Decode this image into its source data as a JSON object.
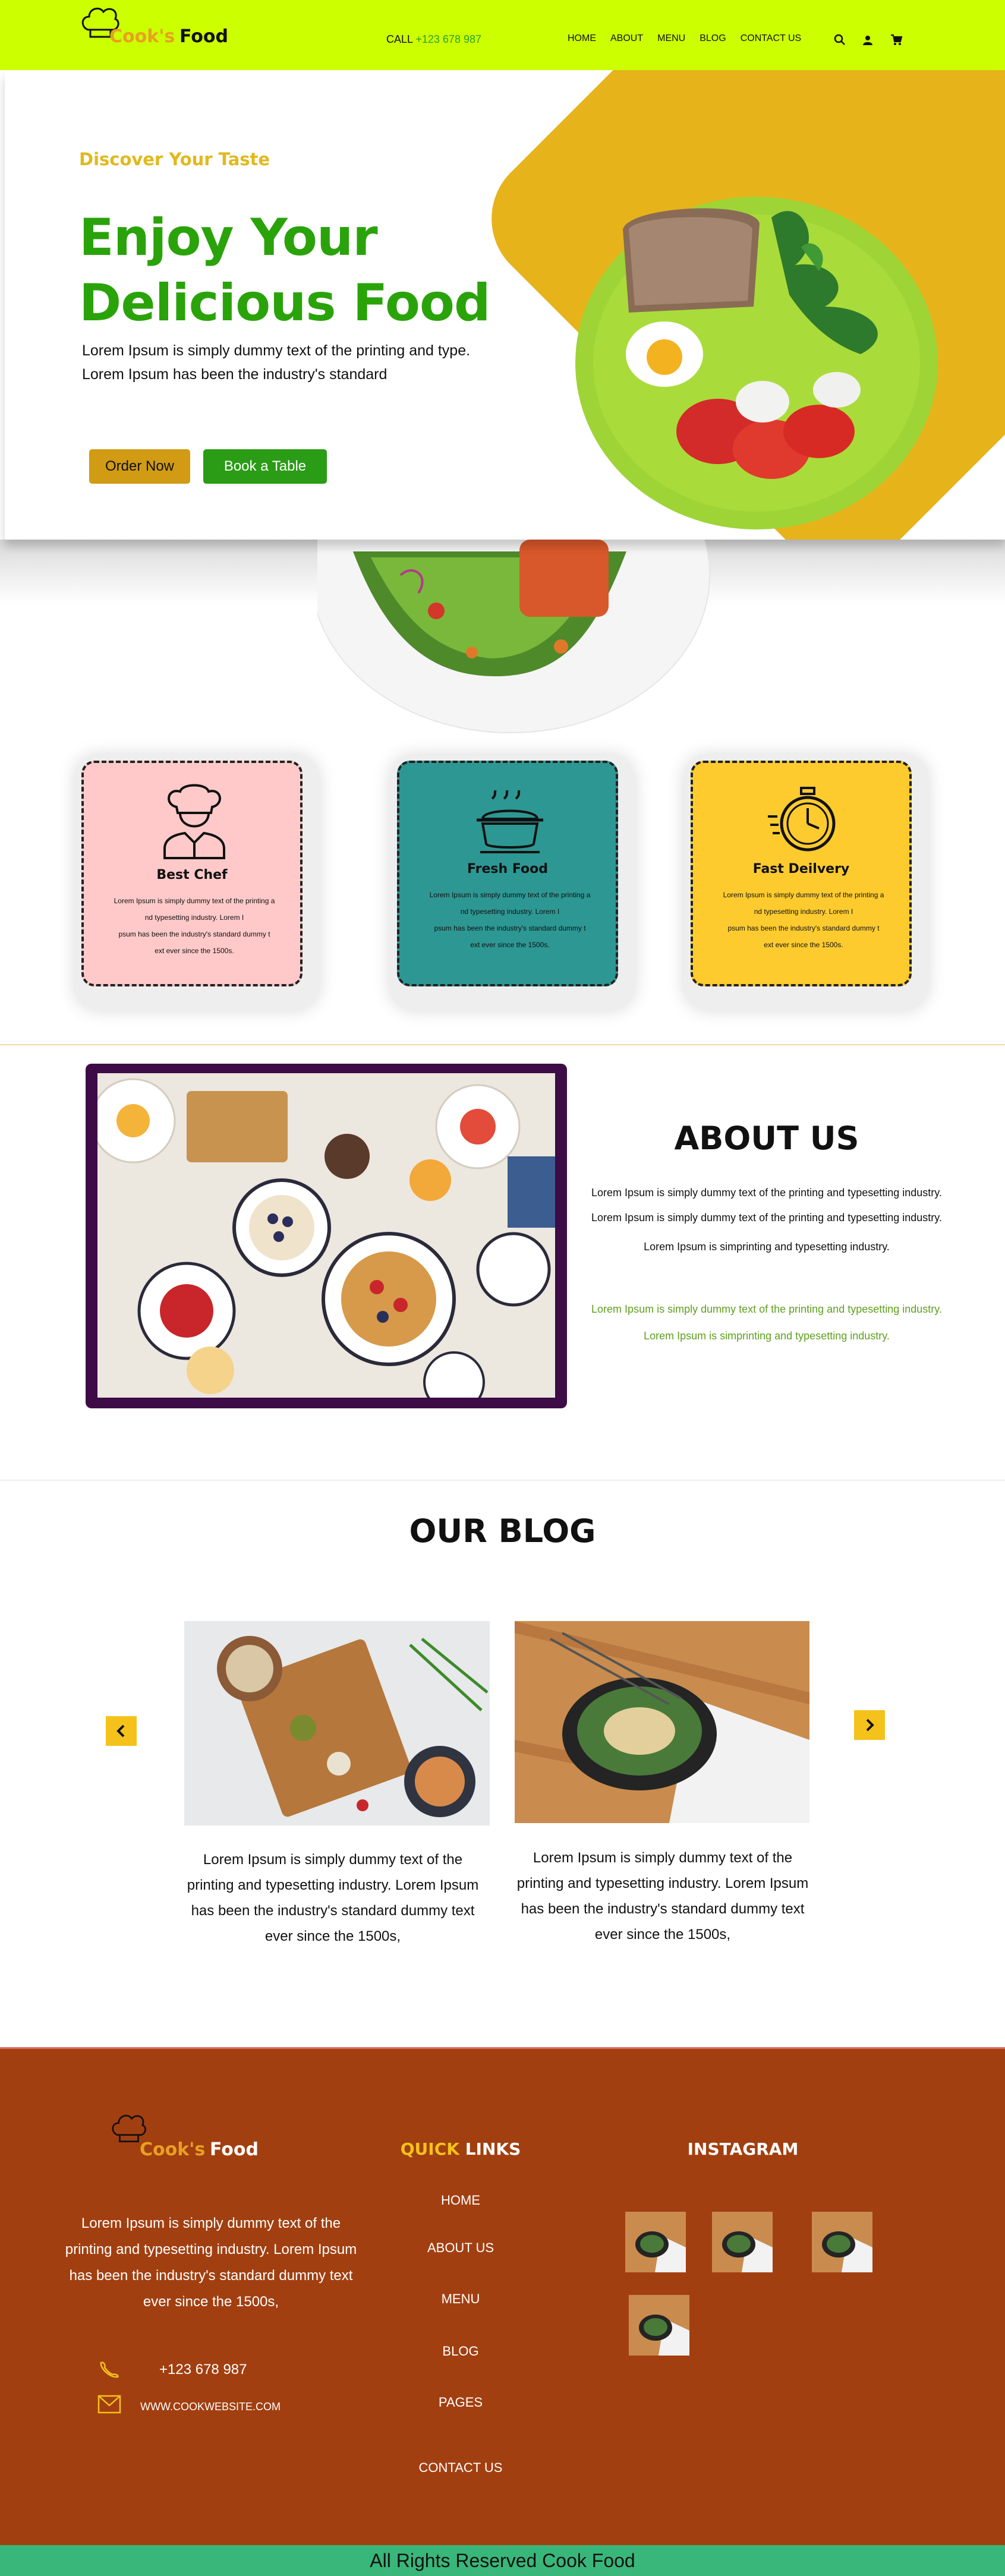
{
  "brand": {
    "name_part1": "Cook's",
    "name_part2": "Food"
  },
  "header": {
    "call_label": "CALL",
    "call_number": "+123 678 987",
    "nav": [
      "HOME",
      "ABOUT",
      "MENU",
      "BLOG",
      "CONTACT US"
    ],
    "icons": [
      "search-icon",
      "user-icon",
      "cart-icon"
    ]
  },
  "hero": {
    "tagline": "Discover Your Taste",
    "title_line1": "Enjoy Your",
    "title_line2": "Delicious Food",
    "text_line1": "Lorem Ipsum is simply dummy text of the printing and type.",
    "text_line2": "Lorem Ipsum has been the industry's standard",
    "order_button": "Order Now",
    "book_button": "Book a Table"
  },
  "features": [
    {
      "title": "Best Chef",
      "icon": "chef-icon",
      "color": "#ffc9c9",
      "lines": [
        "Lorem Ipsum is simply dummy text of the printing a",
        "nd typesetting industry. Lorem I",
        "psum has been the industry's standard dummy t",
        "ext ever since the 1500s."
      ]
    },
    {
      "title": "Fresh Food",
      "icon": "food-pot-icon",
      "color": "#2d9793",
      "lines": [
        "Lorem Ipsum is simply dummy text of the printing a",
        "nd typesetting industry. Lorem I",
        "psum has been the industry's standard dummy t",
        "ext ever since the 1500s."
      ]
    },
    {
      "title": "Fast Deilvery",
      "icon": "stopwatch-icon",
      "color": "#fecb2f",
      "lines": [
        "Lorem Ipsum is simply dummy text of the printing a",
        "nd typesetting industry. Lorem I",
        "psum has been the industry's standard dummy t",
        "ext ever since the 1500s."
      ]
    }
  ],
  "about": {
    "title": "ABOUT US",
    "line1": "Lorem Ipsum is simply dummy text of the printing and typesetting industry.",
    "line2": "Lorem Ipsum is simply dummy text of the printing and typesetting industry.",
    "line3": "Lorem Ipsum is simprinting and typesetting industry.",
    "line4": "Lorem Ipsum is simply dummy text of the printing and typesetting industry.",
    "line5": "Lorem Ipsum is simprinting and typesetting industry."
  },
  "blog": {
    "title": "OUR BLOG",
    "posts": [
      {
        "lines": [
          "Lorem Ipsum is simply dummy text of the",
          "printing and typesetting industry. Lorem Ipsum",
          "has been the industry's standard dummy text",
          "ever since the 1500s,"
        ]
      },
      {
        "lines": [
          "Lorem Ipsum is simply dummy text of the",
          "printing and typesetting industry. Lorem Ipsum",
          "has been the industry's standard dummy text",
          "ever since the 1500s,"
        ]
      }
    ],
    "prev_icon": "chevron-left-icon",
    "next_icon": "chevron-right-icon"
  },
  "footer": {
    "desc_lines": [
      "Lorem Ipsum is simply dummy text of the",
      "printing and typesetting industry. Lorem Ipsum",
      "has been the industry's standard dummy text",
      "ever since the 1500s,"
    ],
    "phone": "+123 678 987",
    "website": "WWW.COOKWEBSITE.COM",
    "quick_links_title_part1": "QUICK",
    "quick_links_title_part2": "LINKS",
    "links": [
      "HOME",
      "ABOUT US",
      "MENU",
      "BLOG",
      "PAGES",
      "CONTACT US"
    ],
    "instagram_title": "INSTAGRAM",
    "copyright": "All Rights  Reserved Cook Food"
  },
  "colors": {
    "header_bg": "#ccff00",
    "hero_accent": "#e6b31a",
    "title_green": "#2aa30a",
    "footer_bg": "#a23f10",
    "bottom_bar": "#39b77a"
  }
}
